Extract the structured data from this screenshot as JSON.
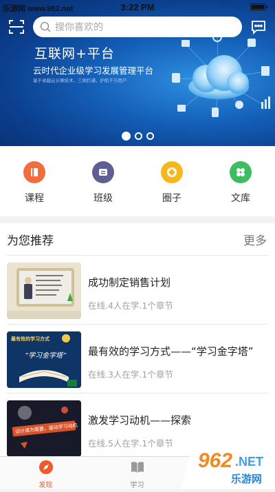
{
  "watermark": "乐游网 www.962.net",
  "status": {
    "time": "3:22 PM"
  },
  "header": {
    "search_placeholder": "搜你喜欢的"
  },
  "banner": {
    "title": "互联网+平台",
    "subtitle": "云时代企业级学习发展管理平台",
    "tagline": "基于卓越云计算技术，三网打通，护航千万用户",
    "page_count": 3,
    "active_page": 1
  },
  "quick_nav": [
    {
      "label": "课程",
      "icon": "book-icon",
      "color": "#f26d3d"
    },
    {
      "label": "班级",
      "icon": "class-icon",
      "color": "#5f5f93"
    },
    {
      "label": "圈子",
      "icon": "circle-icon",
      "color": "#f5b81a"
    },
    {
      "label": "文库",
      "icon": "library-icon",
      "color": "#3dbd5f"
    }
  ],
  "recommend": {
    "title": "为您推荐",
    "more": "更多",
    "courses": [
      {
        "title": "成功制定销售计划",
        "meta": "在线.4人在学.1个章节",
        "thumb_text": ""
      },
      {
        "title": "最有效的学习方式——“学习金字塔”",
        "meta": "在线.3人在学.1个章节",
        "thumb_text": "“学习金字塔”",
        "thumb_heading": "最有效的学习方式"
      },
      {
        "title": "激发学习动机——探索",
        "meta": "在线.5人在学.1个章节",
        "thumb_text": "设计成为需要，驱动学习动机"
      }
    ]
  },
  "tabbar": [
    {
      "label": "发现",
      "icon": "compass-icon",
      "active": true
    },
    {
      "label": "学习",
      "icon": "open-book-icon",
      "active": false
    }
  ],
  "corner_logo": {
    "number": "962",
    "suffix": ".NET",
    "text": "乐游网"
  },
  "colors": {
    "accent": "#ee5a2a",
    "banner": "#1460b8"
  }
}
